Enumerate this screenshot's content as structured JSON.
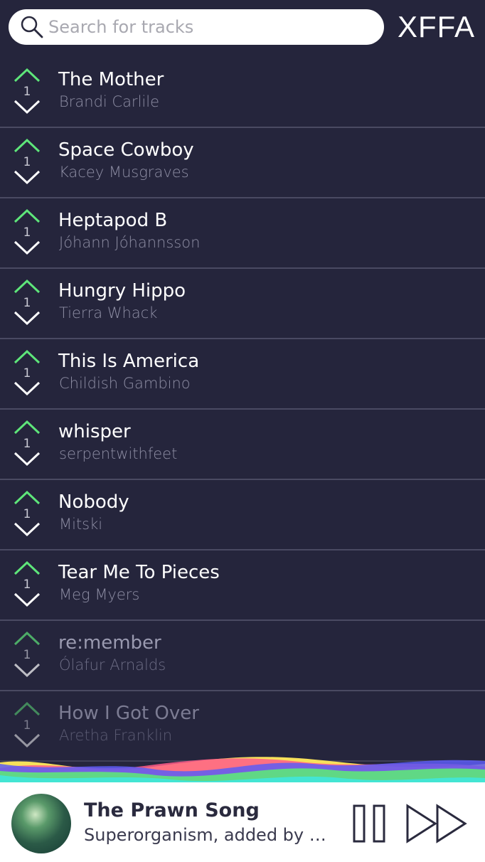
{
  "header": {
    "search_placeholder": "Search for tracks",
    "logo": "XFFA"
  },
  "tracks": [
    {
      "title": "The Mother",
      "artist": "Brandi Carlile",
      "votes": "1"
    },
    {
      "title": "Space Cowboy",
      "artist": "Kacey Musgraves",
      "votes": "1"
    },
    {
      "title": "Heptapod B",
      "artist": "Jóhann Jóhannsson",
      "votes": "1"
    },
    {
      "title": "Hungry Hippo",
      "artist": "Tierra Whack",
      "votes": "1"
    },
    {
      "title": "This Is America",
      "artist": "Childish Gambino",
      "votes": "1"
    },
    {
      "title": "whisper",
      "artist": "serpentwithfeet",
      "votes": "1"
    },
    {
      "title": "Nobody",
      "artist": "Mitski",
      "votes": "1"
    },
    {
      "title": "Tear Me To Pieces",
      "artist": "Meg Myers",
      "votes": "1"
    },
    {
      "title": "re:member",
      "artist": "Ólafur Arnalds",
      "votes": "1"
    },
    {
      "title": "How I Got Over",
      "artist": "Aretha Franklin",
      "votes": "1"
    }
  ],
  "player": {
    "title": "The Prawn Song",
    "subtitle": "Superorganism, added by h..."
  },
  "colors": {
    "background": "#25253c",
    "upvote": "#5ee67a",
    "downvote": "#ffffff",
    "divider": "#4a4a62"
  },
  "icons": {
    "search": "search-icon",
    "upvote": "chevron-up-icon",
    "downvote": "chevron-down-icon",
    "pause": "pause-icon",
    "next": "skip-forward-icon"
  }
}
